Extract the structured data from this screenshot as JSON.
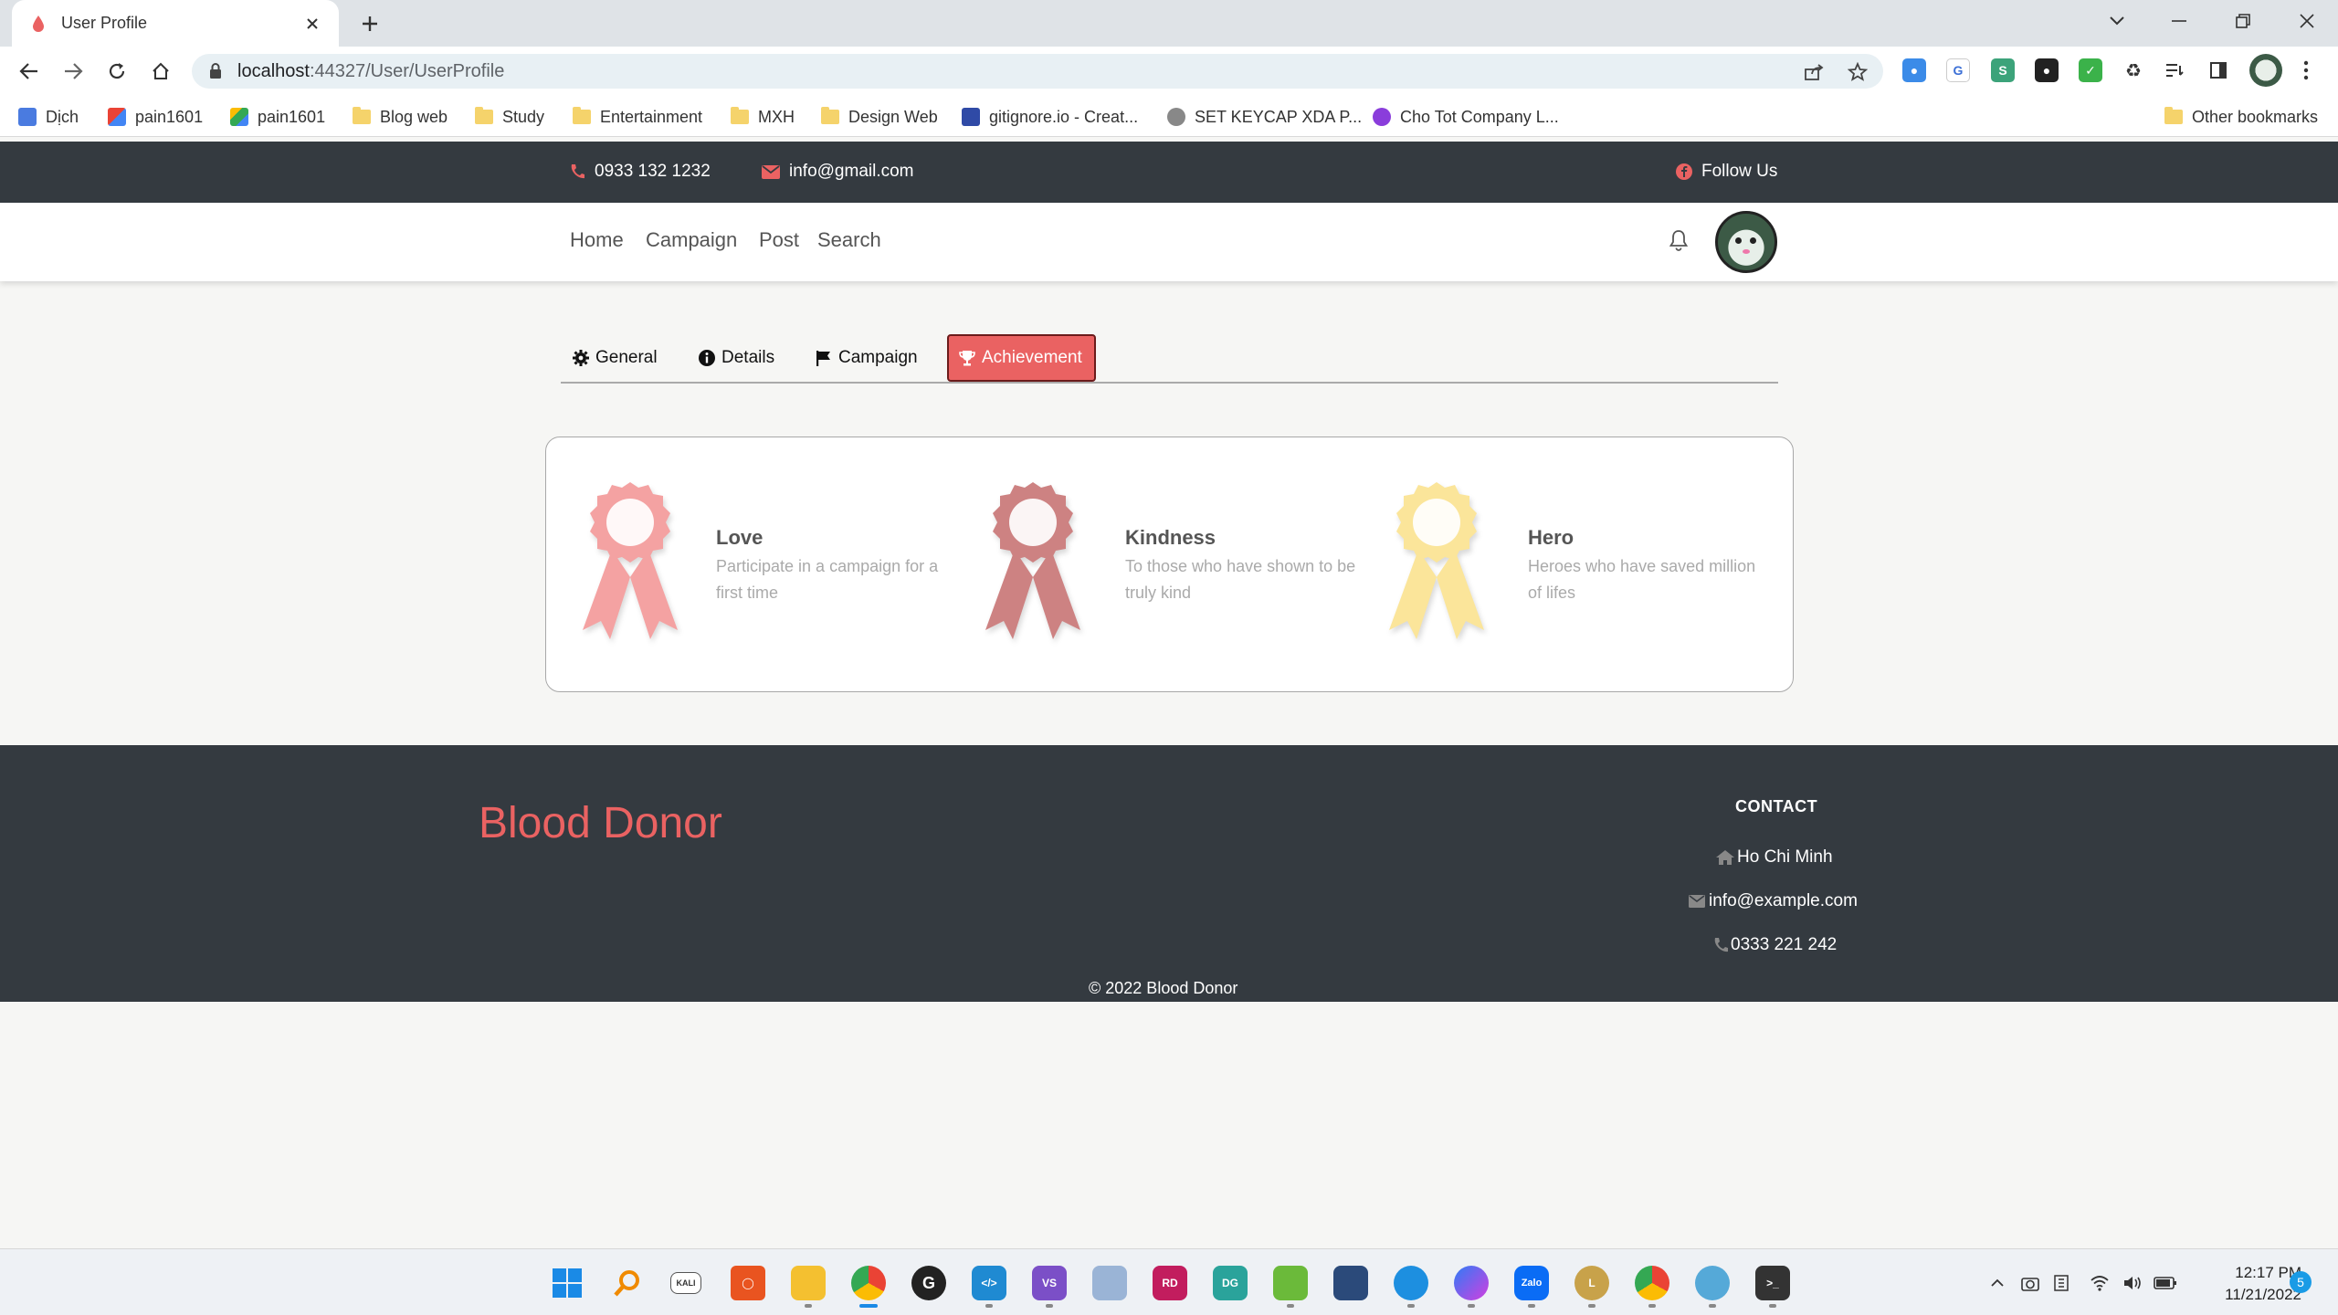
{
  "browser": {
    "tab_title": "User Profile",
    "url_host": "localhost",
    "url_path": ":44327/User/UserProfile",
    "bookmarks": [
      {
        "label": "Dịch"
      },
      {
        "label": "pain1601"
      },
      {
        "label": "pain1601"
      },
      {
        "label": "Blog web"
      },
      {
        "label": "Study"
      },
      {
        "label": "Entertainment"
      },
      {
        "label": "MXH"
      },
      {
        "label": "Design Web"
      },
      {
        "label": "gitignore.io - Creat..."
      },
      {
        "label": "SET KEYCAP XDA P..."
      },
      {
        "label": "Cho Tot Company L..."
      }
    ],
    "other_bookmarks": "Other bookmarks"
  },
  "topbar": {
    "phone": "0933 132 1232",
    "email": "info@gmail.com",
    "follow": "Follow Us"
  },
  "nav": {
    "home": "Home",
    "campaign": "Campaign",
    "post": "Post",
    "search": "Search"
  },
  "profile_tabs": {
    "general": "General",
    "details": "Details",
    "campaign": "Campaign",
    "achievement": "Achievement"
  },
  "achievements": [
    {
      "title": "Love",
      "description": "Participate in a campaign for a first time",
      "color": "#f4a2a2"
    },
    {
      "title": "Kindness",
      "description": "To those who have shown to be truly kind",
      "color": "#cd8282"
    },
    {
      "title": "Hero",
      "description": "Heroes who have saved million of lifes",
      "color": "#fbe59a"
    }
  ],
  "footer": {
    "brand": "Blood Donor",
    "contact_heading": "CONTACT",
    "address": "Ho Chi Minh",
    "email": "info@example.com",
    "phone": "0333 221 242",
    "copyright": "© 2022 Blood Donor"
  },
  "taskbar": {
    "time": "12:17 PM",
    "date": "11/21/2022",
    "notifications": "5"
  },
  "colors": {
    "accent": "#ea6262",
    "dark": "#343a40"
  }
}
